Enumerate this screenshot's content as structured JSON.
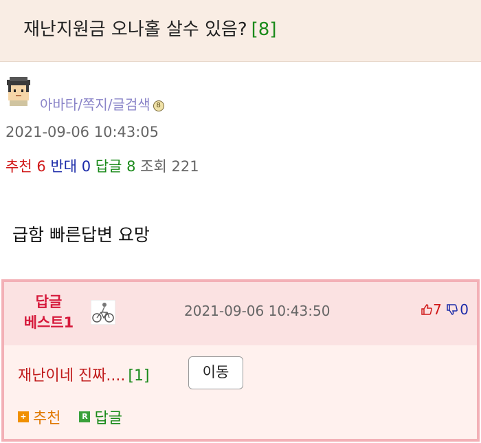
{
  "post": {
    "title": "재난지원금 오나홀 살수 있음?",
    "reply_count_label": "[8]",
    "author_links": "아바타/쪽지/글검색",
    "level_badge": "8",
    "date": "2021-09-06 10:43:05",
    "stats": {
      "recommend_label": "추천",
      "recommend_value": "6",
      "oppose_label": "반대",
      "oppose_value": "0",
      "reply_label": "답글",
      "reply_value": "8",
      "views_label": "조회",
      "views_value": "221"
    },
    "body": "급함 빠른답변 요망"
  },
  "best_reply": {
    "label_line1": "답글",
    "label_line2": "베스트1",
    "date": "2021-09-06 10:43:50",
    "upvotes": "7",
    "downvotes": "0",
    "text": "재난이네 진짜....",
    "count_label": "[1]",
    "move_button": "이동",
    "recommend_action": "추천",
    "recommend_badge": "+",
    "reply_action": "답글",
    "reply_badge": "R"
  },
  "colors": {
    "title_bg": "#f9ede4",
    "best_border": "#f3b0b6",
    "best_header_bg": "#fbe2e2",
    "recommend": "#d01818",
    "oppose": "#1a2aa8",
    "reply": "#1a8a1a",
    "link": "#8a84c8"
  },
  "icons": {
    "avatar": "pixel-avatar-icon",
    "best_avatar": "cyclist-icon",
    "upvote": "thumbs-up-icon",
    "downvote": "thumbs-down-icon"
  }
}
